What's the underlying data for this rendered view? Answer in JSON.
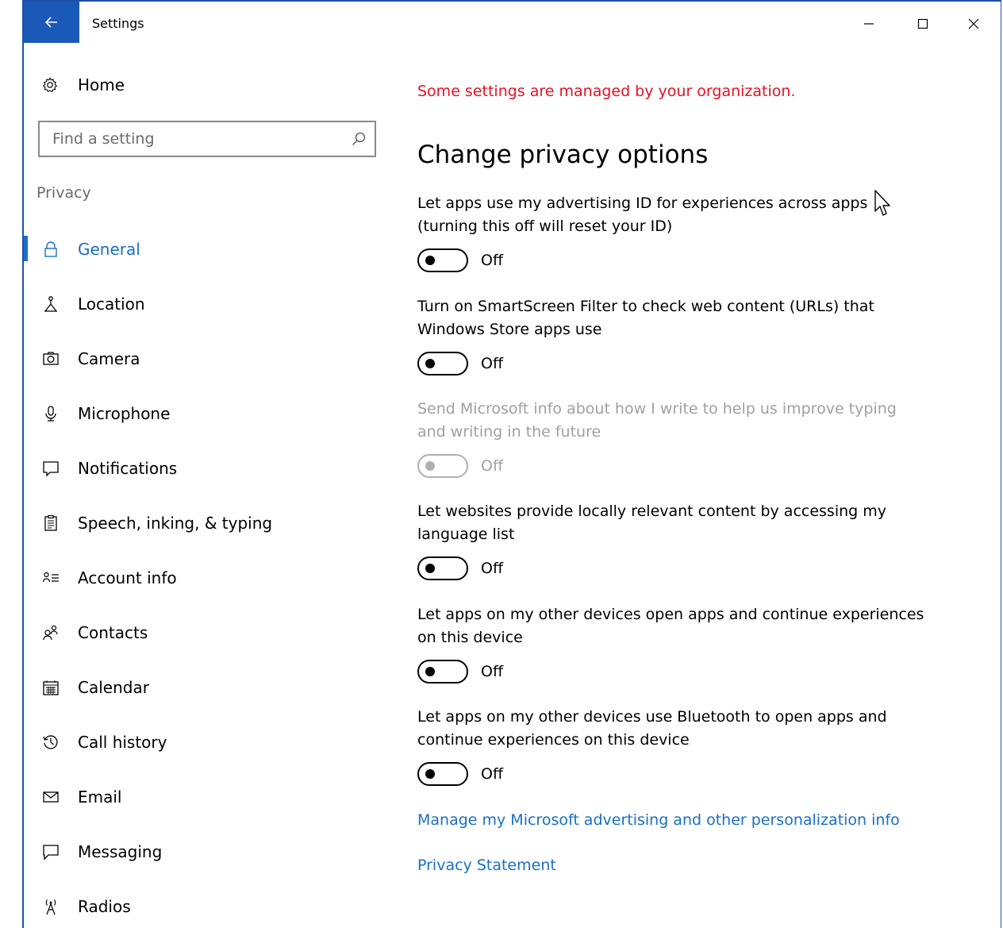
{
  "window": {
    "title": "Settings",
    "accent_color": "#1a59b8"
  },
  "sidebar": {
    "home_label": "Home",
    "search_placeholder": "Find a setting",
    "section_label": "Privacy",
    "items": [
      {
        "label": "General",
        "icon": "lock-icon",
        "active": true
      },
      {
        "label": "Location",
        "icon": "location-icon"
      },
      {
        "label": "Camera",
        "icon": "camera-icon"
      },
      {
        "label": "Microphone",
        "icon": "microphone-icon"
      },
      {
        "label": "Notifications",
        "icon": "notifications-icon"
      },
      {
        "label": "Speech, inking, & typing",
        "icon": "clipboard-icon"
      },
      {
        "label": "Account info",
        "icon": "account-info-icon"
      },
      {
        "label": "Contacts",
        "icon": "contacts-icon"
      },
      {
        "label": "Calendar",
        "icon": "calendar-icon"
      },
      {
        "label": "Call history",
        "icon": "history-icon"
      },
      {
        "label": "Email",
        "icon": "email-icon"
      },
      {
        "label": "Messaging",
        "icon": "messaging-icon"
      },
      {
        "label": "Radios",
        "icon": "radio-antenna-icon"
      }
    ]
  },
  "main": {
    "managed_notice": "Some settings are managed by your organization.",
    "managed_color": "#e81123",
    "heading": "Change privacy options",
    "options": [
      {
        "line1": "Let apps use my advertising ID for experiences across apps",
        "line2": "(turning this off will reset your ID)",
        "state": "Off",
        "disabled": false
      },
      {
        "line1": "Turn on SmartScreen Filter to check web content (URLs) that",
        "line2": "Windows Store apps use",
        "state": "Off",
        "disabled": false
      },
      {
        "line1": "Send Microsoft info about how I write to help us improve typing",
        "line2": "and writing in the future",
        "state": "Off",
        "disabled": true
      },
      {
        "line1": "Let websites provide locally relevant content by accessing my",
        "line2": "language list",
        "state": "Off",
        "disabled": false
      },
      {
        "line1": "Let apps on my other devices open apps and continue experiences",
        "line2": "on this device",
        "state": "Off",
        "disabled": false
      },
      {
        "line1": "Let apps on my other devices use Bluetooth to open apps and",
        "line2": "continue experiences on this device",
        "state": "Off",
        "disabled": false
      }
    ],
    "link_manage": "Manage my Microsoft advertising and other personalization info",
    "link_privacy": "Privacy Statement",
    "link_color": "#1a6fc6"
  }
}
